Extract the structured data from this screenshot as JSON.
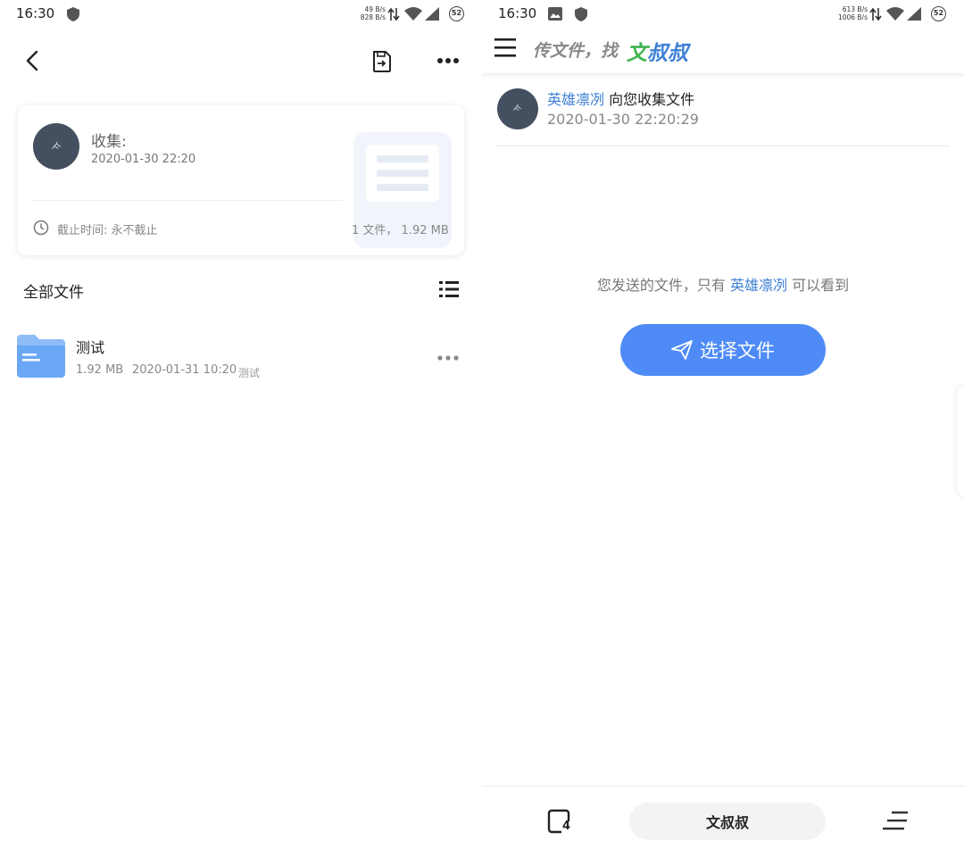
{
  "left": {
    "status": {
      "time": "16:30",
      "net_up": "49 B/s",
      "net_down": "828 B/s",
      "battery": "52"
    },
    "card": {
      "title": "收集:",
      "date": "2020-01-30 22:20",
      "deadline": "截止时间: 永不截止",
      "summary": "1 文件， 1.92 MB"
    },
    "section_title": "全部文件",
    "files": [
      {
        "name": "测试",
        "size": "1.92 MB",
        "date": "2020-01-31 10:20",
        "tag": "测试"
      }
    ]
  },
  "right": {
    "status": {
      "time": "16:30",
      "net_up": "613 B/s",
      "net_down": "1006 B/s",
      "battery": "52"
    },
    "brand": {
      "slogan": "传文件，找",
      "name": "文叔叔"
    },
    "message": {
      "user": "英雄凛冽",
      "text": "向您收集文件",
      "time": "2020-01-30 22:20:29"
    },
    "privacy": {
      "before": "您发送的文件，只有",
      "user": "英雄凛冽",
      "after": "可以看到"
    },
    "select_button": "选择文件",
    "bottom_nav": {
      "badge": "4",
      "center_label": "文叔叔"
    }
  },
  "colors": {
    "accent_blue": "#4e8bf6",
    "link_blue": "#3d7fd6",
    "brand_green": "#3fb34f",
    "folder_blue": "#6aa8f5"
  }
}
